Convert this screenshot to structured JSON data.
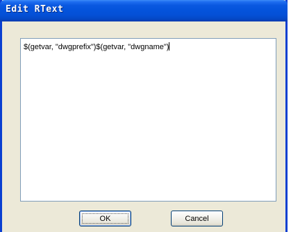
{
  "dialog": {
    "title": "Edit RText",
    "text_value": "$(getvar, \"dwgprefix\")$(getvar, \"dwgname\")",
    "ok_label": "OK",
    "cancel_label": "Cancel"
  },
  "colors": {
    "titlebar": "#0453db",
    "dialog_bg": "#ece9d8",
    "field_border": "#7f9db9",
    "button_border": "#003c74"
  }
}
